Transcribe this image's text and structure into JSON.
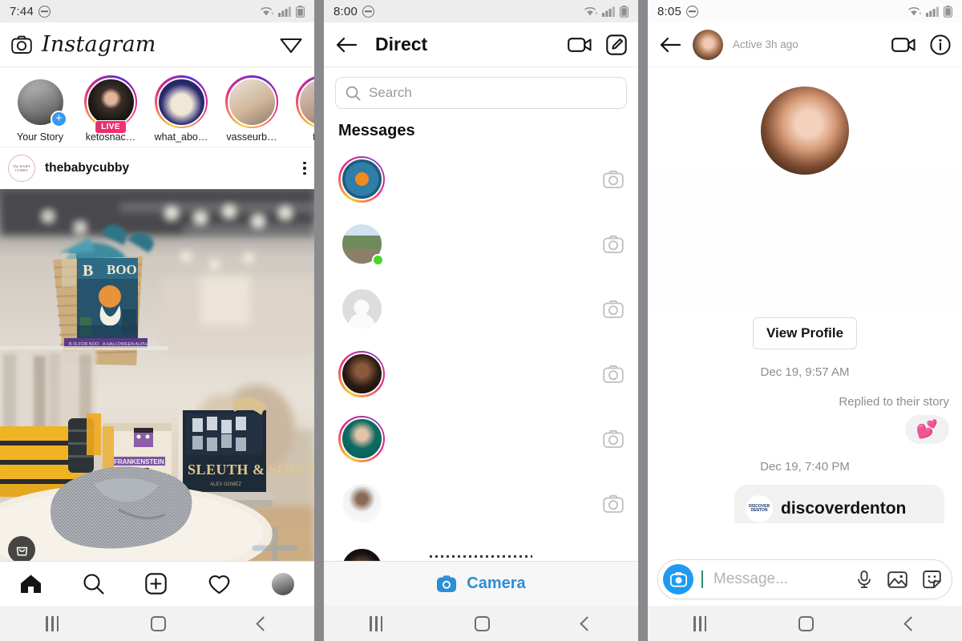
{
  "panels": [
    {
      "id": "feed",
      "status": {
        "time": "7:44",
        "dnd_icon": "do-not-disturb-icon",
        "wifi_icon": "wifi-icon",
        "signal_icon": "cellular-signal-icon",
        "battery_icon": "battery-icon"
      },
      "appbar": {
        "camera_icon": "camera-icon",
        "title": "Instagram",
        "direct_icon": "send-paperplane-icon"
      },
      "stories": [
        {
          "name": "Your Story",
          "ring": "plain",
          "badge": "plus",
          "badge_label": "+"
        },
        {
          "name": "ketosnac…",
          "ring": "gradient",
          "badge": "live",
          "badge_label": "LIVE"
        },
        {
          "name": "what_abo…",
          "ring": "gradient",
          "badge": "none",
          "badge_label": ""
        },
        {
          "name": "vasseurb…",
          "ring": "gradient",
          "badge": "none",
          "badge_label": ""
        },
        {
          "name": "thek",
          "ring": "gradient",
          "badge": "none",
          "badge_label": ""
        }
      ],
      "post": {
        "avatar_text": "The BABY CUBBY",
        "username": "thebabycubby",
        "menu_icon": "more-options-icon",
        "shopping_badge_icon": "shopping-bag-icon"
      },
      "tabbar": [
        {
          "icon": "home-icon",
          "label": "Home"
        },
        {
          "icon": "search-icon",
          "label": "Search"
        },
        {
          "icon": "add-post-icon",
          "label": "New Post"
        },
        {
          "icon": "heart-activity-icon",
          "label": "Activity"
        },
        {
          "icon": "profile-avatar-icon",
          "label": "Profile"
        }
      ],
      "navbar": [
        {
          "icon": "recents-icon",
          "label": "Recents"
        },
        {
          "icon": "home-button-icon",
          "label": "Home"
        },
        {
          "icon": "back-button-icon",
          "label": "Back"
        }
      ]
    },
    {
      "id": "direct",
      "status": {
        "time": "8:00",
        "dnd_icon": "do-not-disturb-icon",
        "wifi_icon": "wifi-icon",
        "signal_icon": "cellular-signal-icon",
        "battery_icon": "battery-icon"
      },
      "appbar": {
        "back_icon": "back-arrow-icon",
        "title": "Direct",
        "video_icon": "video-call-icon",
        "compose_icon": "compose-new-message-icon"
      },
      "search": {
        "icon": "search-icon",
        "placeholder": "Search"
      },
      "section_title": "Messages",
      "threads": [
        {
          "ring": "gradient",
          "avatar": "flowers-mandala",
          "online": false,
          "trailing_icon": "camera-icon"
        },
        {
          "ring": "plain",
          "avatar": "garden-rocks",
          "online": true,
          "trailing_icon": "camera-icon"
        },
        {
          "ring": "plain",
          "avatar": "default-user",
          "online": false,
          "trailing_icon": "camera-icon"
        },
        {
          "ring": "gradient",
          "avatar": "portrait-a",
          "online": false,
          "trailing_icon": "camera-icon"
        },
        {
          "ring": "gradient",
          "avatar": "portrait-b",
          "online": false,
          "trailing_icon": "camera-icon"
        },
        {
          "ring": "plain",
          "avatar": "portrait-c",
          "online": false,
          "trailing_icon": "camera-icon"
        },
        {
          "ring": "plain",
          "avatar": "portrait-d",
          "online": false,
          "trailing_icon": "camera-icon"
        }
      ],
      "camera_bar": {
        "icon": "camera-icon",
        "label": "Camera"
      },
      "navbar": [
        {
          "icon": "recents-icon",
          "label": "Recents"
        },
        {
          "icon": "home-button-icon",
          "label": "Home"
        },
        {
          "icon": "back-button-icon",
          "label": "Back"
        }
      ]
    },
    {
      "id": "chat",
      "status": {
        "time": "8:05",
        "dnd_icon": "do-not-disturb-icon",
        "wifi_icon": "wifi-icon",
        "signal_icon": "cellular-signal-icon",
        "battery_icon": "battery-icon"
      },
      "appbar": {
        "back_icon": "back-arrow-icon",
        "avatar": "contact-selfie",
        "active_status": "Active 3h ago",
        "video_icon": "video-call-icon",
        "info_icon": "info-icon"
      },
      "profile": {
        "avatar": "contact-selfie",
        "view_profile_label": "View Profile"
      },
      "timeline": [
        {
          "type": "timestamp",
          "text": "Dec 19, 9:57 AM"
        },
        {
          "type": "reply-label",
          "text": "Replied to their story"
        },
        {
          "type": "bubble",
          "text": "💕",
          "side": "right"
        },
        {
          "type": "timestamp",
          "text": "Dec 19, 7:40 PM"
        }
      ],
      "peek_card": {
        "logo_text": "DISCOVER DENTON",
        "name": "discoverdenton"
      },
      "composer": {
        "camera_icon": "camera-icon",
        "placeholder": "Message...",
        "mic_icon": "microphone-icon",
        "gallery_icon": "photo-gallery-icon",
        "sticker_icon": "sticker-icon"
      },
      "navbar": [
        {
          "icon": "recents-icon",
          "label": "Recents"
        },
        {
          "icon": "home-button-icon",
          "label": "Home"
        },
        {
          "icon": "back-button-icon",
          "label": "Back"
        }
      ]
    }
  ],
  "colors": {
    "instagram_blue": "#3897f0",
    "camera_blue": "#2b8fd6",
    "online_green": "#45d62a",
    "live_pink": "#e1306c",
    "status_bg": "#ededed",
    "divider": "#8a8a8e"
  }
}
